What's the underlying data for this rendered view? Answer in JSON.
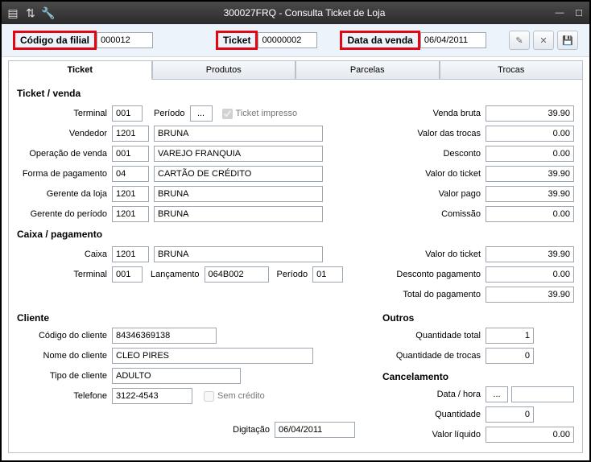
{
  "window": {
    "title": "300027FRQ - Consulta Ticket de Loja"
  },
  "top": {
    "codigo_filial_label": "Código da filial",
    "codigo_filial_value": "000012",
    "ticket_label": "Ticket",
    "ticket_value": "00000002",
    "data_venda_label": "Data da venda",
    "data_venda_value": "06/04/2011"
  },
  "tabs": {
    "t0": "Ticket",
    "t1": "Produtos",
    "t2": "Parcelas",
    "t3": "Trocas"
  },
  "section_titles": {
    "ticket_venda": "Ticket / venda",
    "caixa_pag": "Caixa / pagamento",
    "cliente": "Cliente",
    "outros": "Outros",
    "cancelamento": "Cancelamento"
  },
  "labels": {
    "terminal": "Terminal",
    "periodo": "Período",
    "ticket_impresso": "Ticket impresso",
    "vendedor": "Vendedor",
    "operacao": "Operação de venda",
    "forma_pag": "Forma de pagamento",
    "gerente_loja": "Gerente da loja",
    "gerente_periodo": "Gerente do período",
    "caixa": "Caixa",
    "lancamento": "Lançamento",
    "codigo_cliente": "Código do cliente",
    "nome_cliente": "Nome do cliente",
    "tipo_cliente": "Tipo de cliente",
    "telefone": "Telefone",
    "sem_credito": "Sem crédito",
    "digitacao": "Digitação",
    "venda_bruta": "Venda bruta",
    "valor_trocas": "Valor das trocas",
    "desconto": "Desconto",
    "valor_ticket": "Valor do ticket",
    "valor_pago": "Valor pago",
    "comissao": "Comissão",
    "desconto_pag": "Desconto pagamento",
    "total_pag": "Total do pagamento",
    "qtd_total": "Quantidade total",
    "qtd_trocas": "Quantidade de trocas",
    "data_hora": "Data / hora",
    "quantidade": "Quantidade",
    "valor_liquido": "Valor líquido",
    "more": "..."
  },
  "tv": {
    "terminal": "001",
    "vendedor_cod": "1201",
    "vendedor_nome": "BRUNA",
    "operacao_cod": "001",
    "operacao_nome": "VAREJO FRANQUIA",
    "forma_cod": "04",
    "forma_nome": "CARTÃO DE CRÉDITO",
    "gerente_loja_cod": "1201",
    "gerente_loja_nome": "BRUNA",
    "gerente_per_cod": "1201",
    "gerente_per_nome": "BRUNA"
  },
  "caixa": {
    "caixa_cod": "1201",
    "caixa_nome": "BRUNA",
    "terminal": "001",
    "lancamento": "064B002",
    "periodo": "01"
  },
  "cliente": {
    "codigo": "84346369138",
    "nome": "CLEO PIRES",
    "tipo": "ADULTO",
    "telefone": "3122-4543"
  },
  "digitacao": "06/04/2011",
  "vals_r": {
    "venda_bruta": "39.90",
    "valor_trocas": "0.00",
    "desconto": "0.00",
    "valor_ticket": "39.90",
    "valor_pago": "39.90",
    "comissao": "0.00",
    "valor_ticket2": "39.90",
    "desconto_pag": "0.00",
    "total_pag": "39.90",
    "qtd_total": "1",
    "qtd_trocas": "0",
    "canc_qtd": "0",
    "canc_valor": "0.00"
  }
}
